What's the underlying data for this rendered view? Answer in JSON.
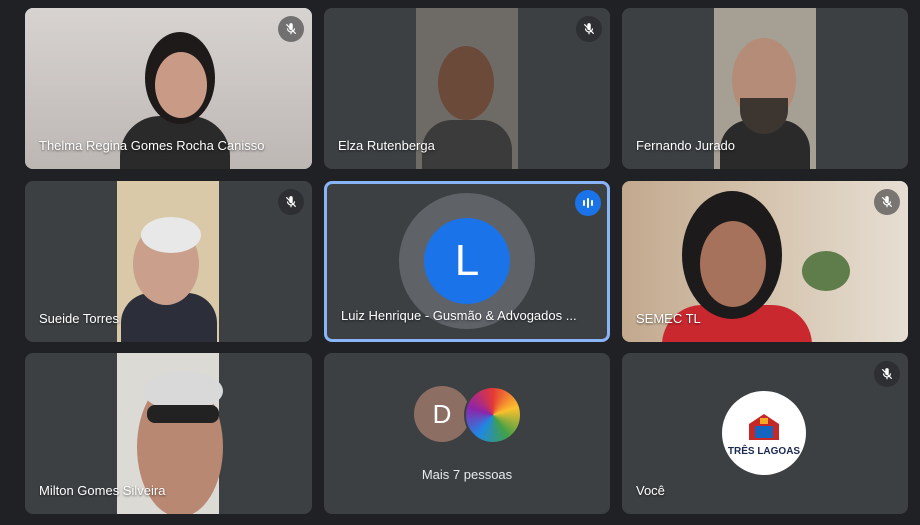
{
  "participants": [
    {
      "name": "Thelma Regina Gomes Rocha Canisso",
      "muted": true
    },
    {
      "name": "Elza Rutenberga",
      "muted": true
    },
    {
      "name": "Fernando Jurado",
      "muted": false
    },
    {
      "name": "Sueide Torres",
      "muted": true
    },
    {
      "name": "Luiz Henrique - Gusmão & Advogados ...",
      "initial": "L",
      "speaking": true
    },
    {
      "name": "SEMEC TL",
      "muted": true
    },
    {
      "name": "Milton Gomes Silveira",
      "muted": false
    }
  ],
  "more_people": {
    "label": "Mais 7 pessoas",
    "initial": "D"
  },
  "self": {
    "name": "Você",
    "muted": true,
    "logo_text": "TRÊS LAGOAS"
  },
  "colors": {
    "active_border": "#8ab4f8",
    "speaking": "#1a73e8",
    "avatar_L": "#1a73e8",
    "avatar_D": "#8d6e63"
  },
  "icons": {
    "muted": "mic-off-icon",
    "speaking": "audio-level-icon"
  }
}
